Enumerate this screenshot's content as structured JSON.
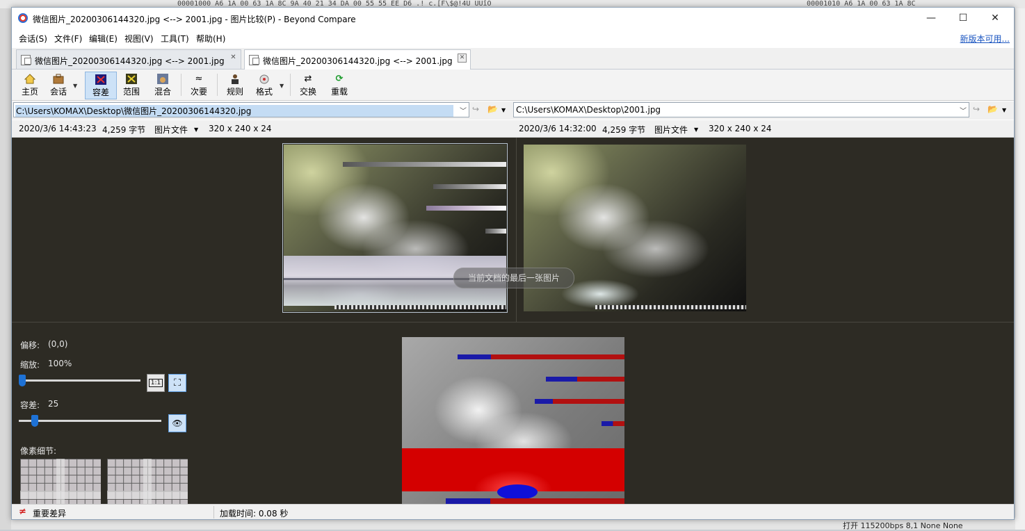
{
  "background": {
    "hex_left": "00001000 A6 1A 00 63 1A 8C 9A 40  21 34 DA 00 55 55 EE D6  .! c.[F\\$@!4Ú UUîÖ",
    "hex_right": "00001010 A6 1A 00 63 1A 8C",
    "bottom_text": "打开  115200bps 8,1 None None"
  },
  "window": {
    "title": "微信图片_20200306144320.jpg <--> 2001.jpg - 图片比较(P) - Beyond Compare",
    "controls": {
      "minimize": "—",
      "maximize": "☐",
      "close": "✕"
    }
  },
  "menu": {
    "items": [
      "会话(S)",
      "文件(F)",
      "编辑(E)",
      "视图(V)",
      "工具(T)",
      "帮助(H)"
    ],
    "update_link": "新版本可用..."
  },
  "tabs": [
    {
      "label": "微信图片_20200306144320.jpg <--> 2001.jpg",
      "close": "✕"
    },
    {
      "label": "微信图片_20200306144320.jpg <--> 2001.jpg",
      "close": "✕"
    }
  ],
  "toolbar": {
    "home": "主页",
    "session": "会话",
    "tolerance": "容差",
    "range": "范围",
    "blend": "混合",
    "next": "次要",
    "rules": "规则",
    "format": "格式",
    "swap": "交换",
    "reload": "重载"
  },
  "paths": {
    "left": "C:\\Users\\KOMAX\\Desktop\\微信图片_20200306144320.jpg",
    "right": "C:\\Users\\KOMAX\\Desktop\\2001.jpg"
  },
  "info": {
    "left": {
      "date": "2020/3/6 14:43:23",
      "size": "4,259 字节",
      "type": "图片文件",
      "dims": "320 x 240 x 24"
    },
    "right": {
      "date": "2020/3/6 14:32:00",
      "size": "4,259 字节",
      "type": "图片文件",
      "dims": "320 x 240 x 24"
    }
  },
  "toast": "当前文档的最后一张图片",
  "panel": {
    "offset_label": "偏移:",
    "offset_value": "(0,0)",
    "zoom_label": "缩放:",
    "zoom_value": "100%",
    "tolerance_label": "容差:",
    "tolerance_value": "25",
    "pixel_detail_label": "像素细节:"
  },
  "status": {
    "diff": "重要差异",
    "load_time": "加载时间: 0.08 秒"
  }
}
